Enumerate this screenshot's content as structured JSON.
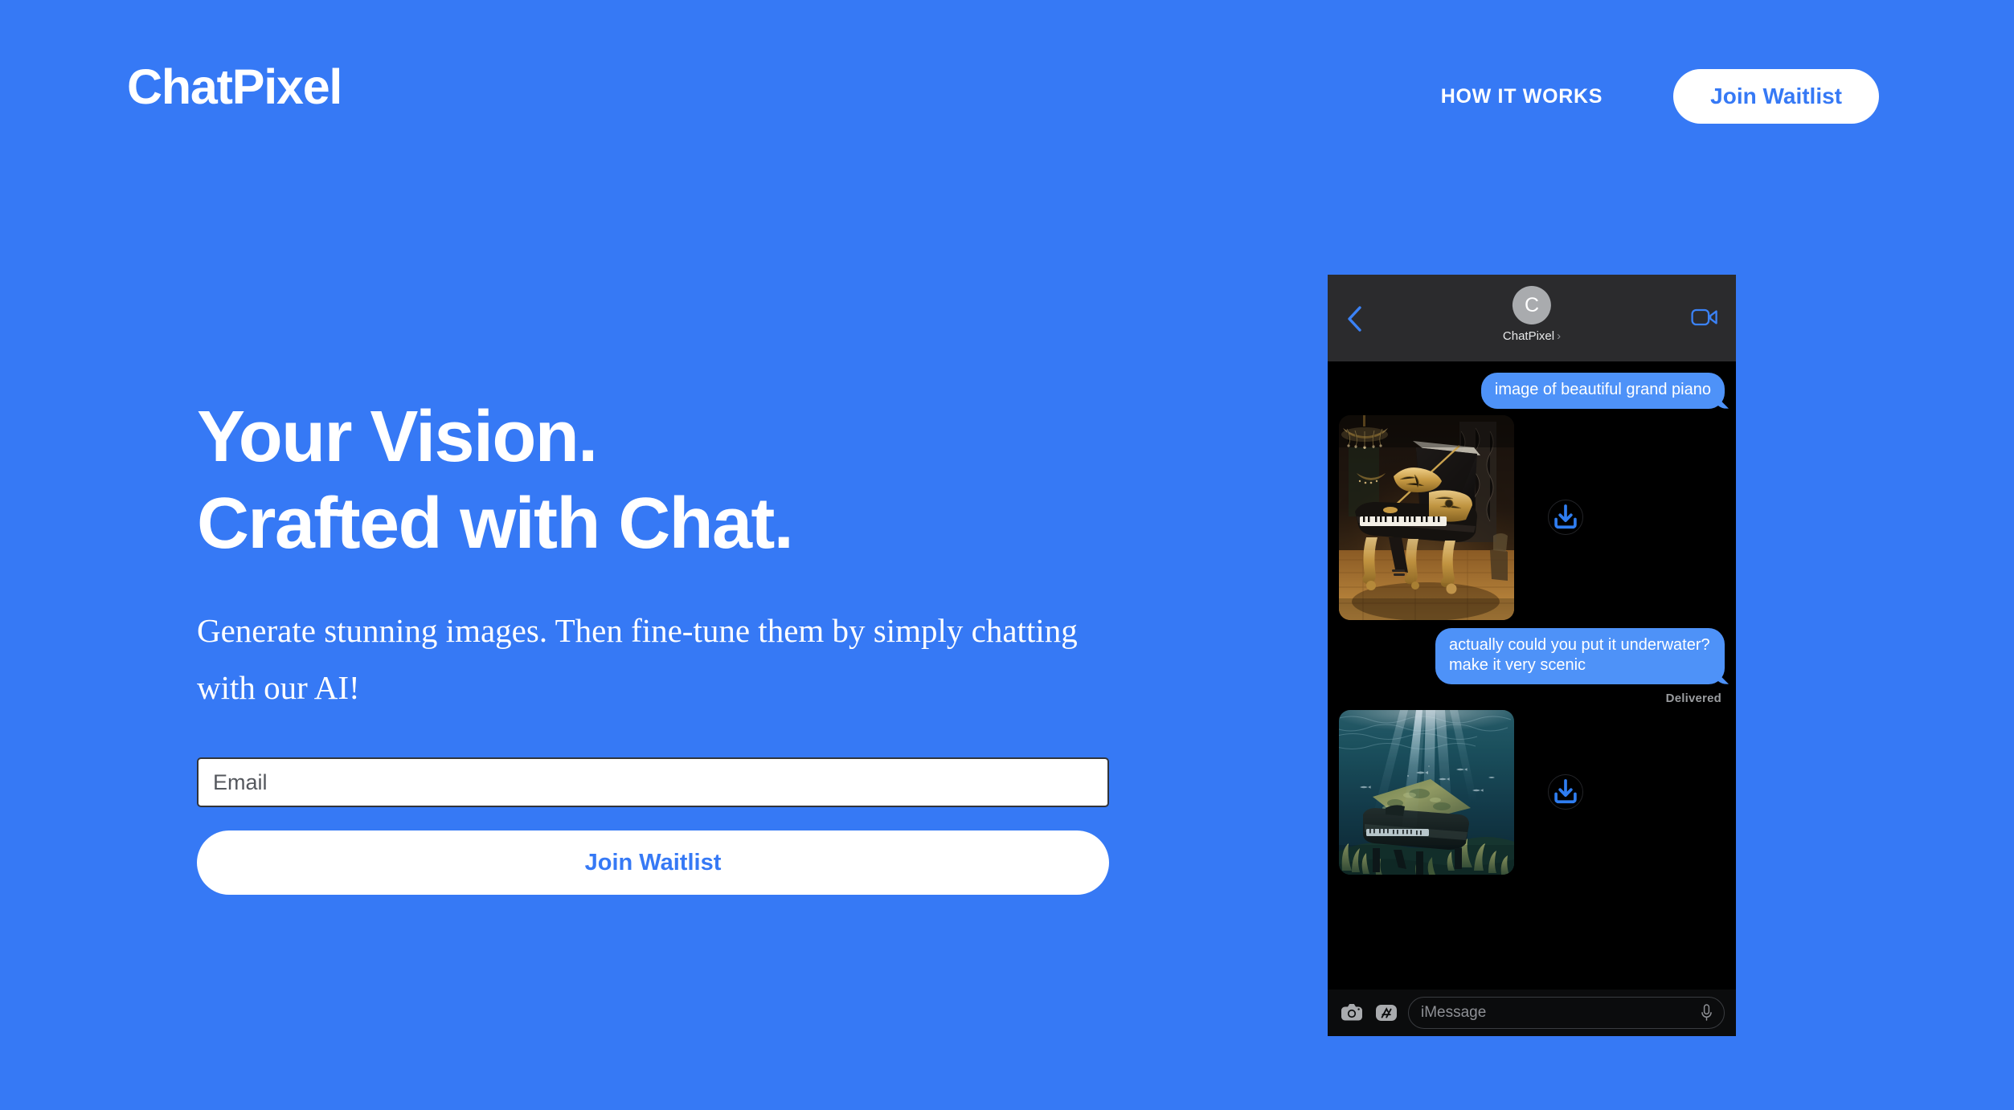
{
  "brand": {
    "name": "ChatPixel"
  },
  "nav": {
    "link_label": "HOW IT WORKS",
    "cta_label": "Join Waitlist"
  },
  "hero": {
    "title_line1": "Your Vision.",
    "title_line2": "Crafted with Chat.",
    "subtitle": "Generate stunning images. Then fine-tune them by simply chatting with our AI!",
    "email_placeholder": "Email",
    "email_value": "",
    "submit_label": "Join Waitlist"
  },
  "colors": {
    "background": "#3679f5",
    "accent_on_white": "#3679f5",
    "bubble_blue": "#4e92f8",
    "phone_header": "#2b2b2d",
    "phone_body": "#000000",
    "download_icon": "#2f7df0"
  },
  "phone": {
    "header": {
      "back_icon": "chevron-left-icon",
      "avatar_initial": "C",
      "contact_name": "ChatPixel",
      "contact_chevron": "›",
      "facetime_icon": "video-camera-icon"
    },
    "messages": [
      {
        "type": "text",
        "sender": "outgoing",
        "text": "image of beautiful grand piano"
      },
      {
        "type": "image",
        "sender": "incoming",
        "alt": "ornate black and gold grand piano in a warmly lit room with a chandelier",
        "download_icon": "download-icon",
        "size": "tall"
      },
      {
        "type": "text",
        "sender": "outgoing",
        "text": "actually could you put it underwater? make it very scenic",
        "status": "Delivered"
      },
      {
        "type": "image",
        "sender": "incoming",
        "alt": "grand piano submerged underwater on a coral reef with light rays from the surface",
        "download_icon": "download-icon",
        "size": "short"
      }
    ],
    "composer": {
      "camera_icon": "camera-icon",
      "apps_icon": "app-store-icon",
      "placeholder": "iMessage",
      "value": "",
      "mic_icon": "microphone-icon"
    }
  }
}
